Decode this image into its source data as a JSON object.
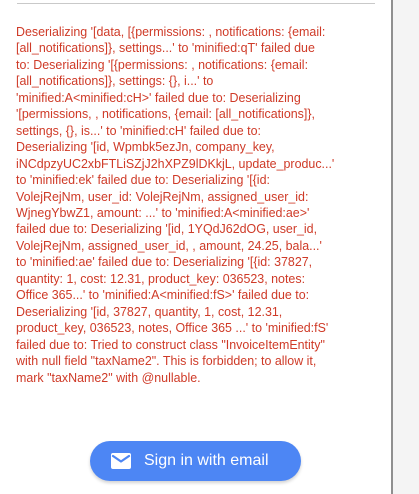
{
  "error": {
    "message": "Deserializing '[data, [{permissions: , notifications: {email:\n[all_notifications]}, settings...' to 'minified:qT' failed due\nto: Deserializing '[{permissions: , notifications: {email:\n[all_notifications]}, settings: {}, i...' to\n'minified:A<minified:cH>' failed due to: Deserializing\n'[permissions, , notifications, {email: [all_notifications]},\nsettings, {}, is...' to 'minified:cH' failed due to:\nDeserializing '[id, Wpmbk5ezJn, company_key,\niNCdpzyUC2xbFTLiSZjJ2hXPZ9lDKkjL, update_produc...'\nto 'minified:ek' failed due to: Deserializing '[{id:\nVolejRejNm, user_id: VolejRejNm, assigned_user_id:\nWjnegYbwZ1, amount: ...' to 'minified:A<minified:ae>'\nfailed due to: Deserializing '[id, 1YQdJ62dOG, user_id,\nVolejRejNm, assigned_user_id, , amount, 24.25, bala...'\nto 'minified:ae' failed due to: Deserializing '[{id: 37827,\nquantity: 1, cost: 12.31, product_key: 036523, notes:\nOffice 365...' to 'minified:A<minified:fS>' failed due to:\nDeserializing '[id, 37827, quantity, 1, cost, 12.31,\nproduct_key, 036523, notes, Office 365 ...' to 'minified:fS'\nfailed due to: Tried to construct class \"InvoiceItemEntity\"\nwith null field \"taxName2\". This is forbidden; to allow it,\nmark \"taxName2\" with @nullable."
  },
  "signin": {
    "label": "Sign in with email",
    "icon": "mail-icon"
  },
  "colors": {
    "error_text": "#cf3a27",
    "button_background": "#4d86f4",
    "button_text": "#ffffff",
    "gutter": "#f4f4f4"
  }
}
